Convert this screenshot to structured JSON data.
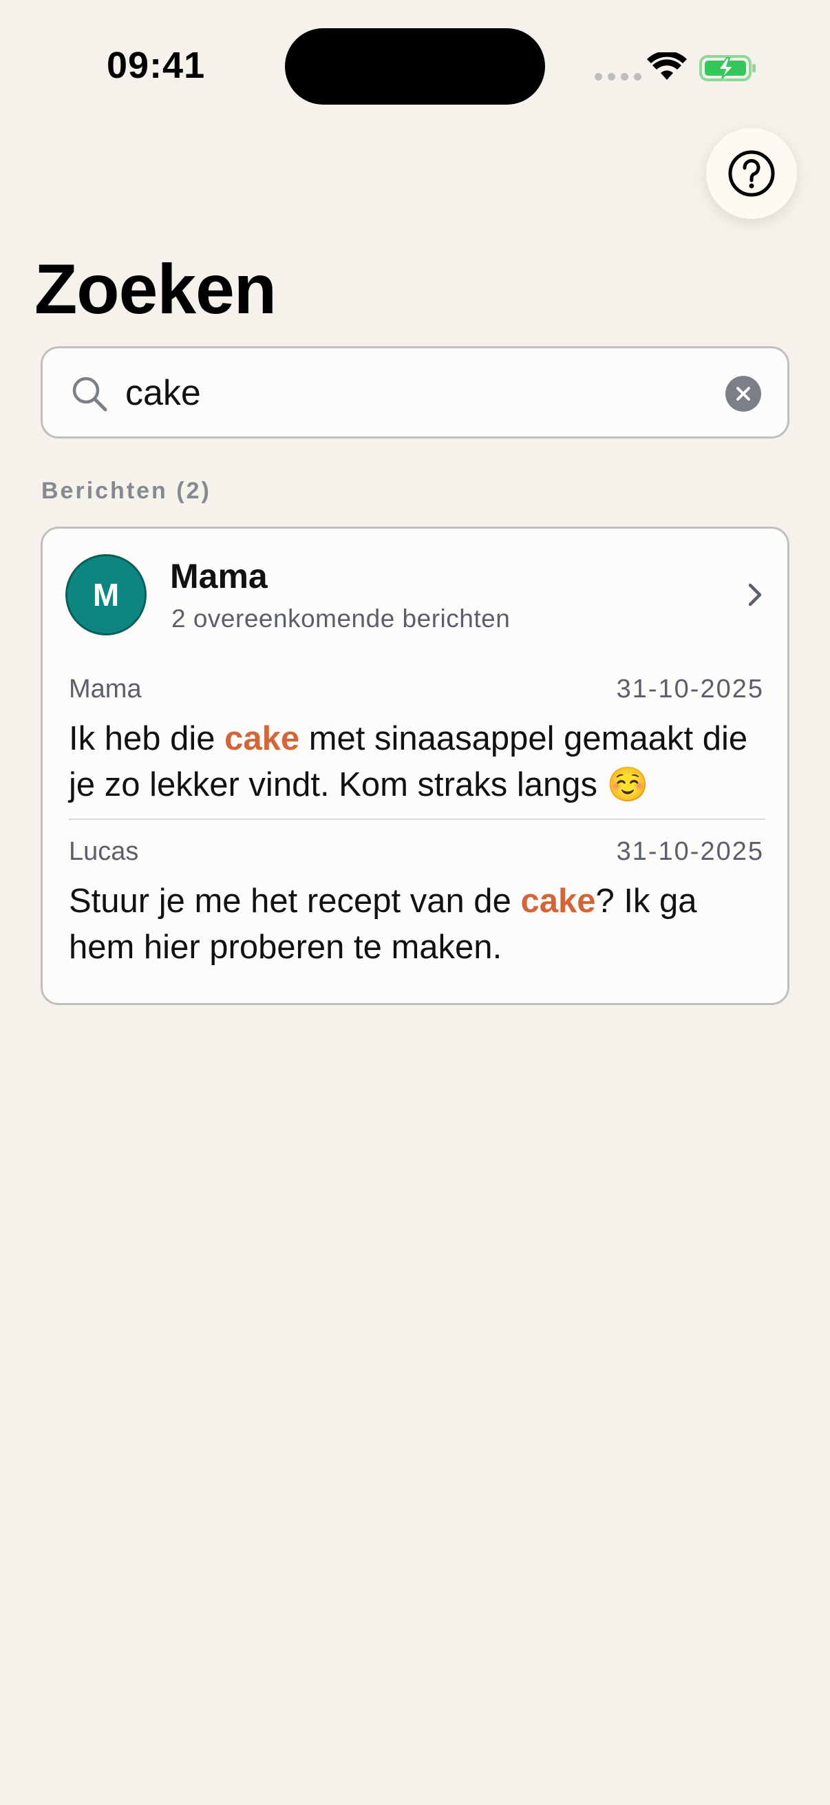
{
  "status_bar": {
    "time": "09:41"
  },
  "header": {
    "title": "Zoeken",
    "help_icon": "question-circle-icon"
  },
  "search": {
    "value": "cake",
    "placeholder": ""
  },
  "results": {
    "section_label": "Berichten (2)",
    "conversation": {
      "avatar_initial": "M",
      "avatar_color": "#0E8680",
      "name": "Mama",
      "subtitle": "2 overeenkomende berichten"
    },
    "messages": [
      {
        "sender": "Mama",
        "date": "31-10-2025",
        "text_before": "Ik heb die ",
        "highlight": "cake",
        "text_after": " met sinaasappel gemaakt die je zo lekker vindt. Kom straks langs ☺️"
      },
      {
        "sender": "Lucas",
        "date": "31-10-2025",
        "text_before": "Stuur je me het recept van de ",
        "highlight": "cake",
        "text_after": "? Ik ga hem hier proberen te maken."
      }
    ]
  },
  "colors": {
    "background": "#F5F2EB",
    "highlight": "#D2663A",
    "battery_green": "#34C759"
  }
}
